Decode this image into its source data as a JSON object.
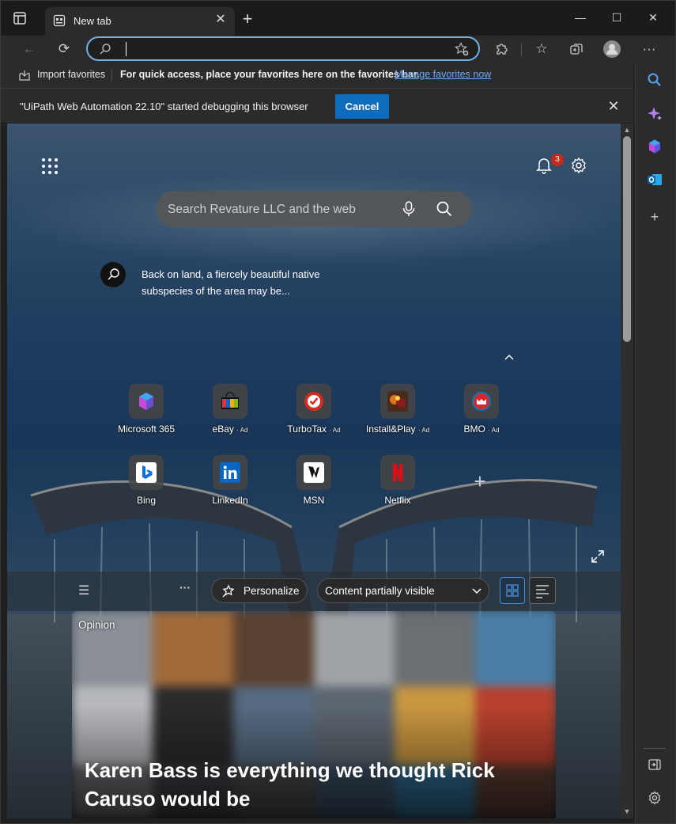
{
  "tab": {
    "title": "New tab"
  },
  "address": {
    "value": ""
  },
  "favorites_bar": {
    "import_label": "Import favorites",
    "message": "For quick access, place your favorites here on the favorites bar.",
    "manage_link": "Manage favorites now"
  },
  "infobar": {
    "message": "\"UiPath Web Automation 22.10\" started debugging this browser",
    "cancel_label": "Cancel"
  },
  "newtab": {
    "notification_count": "3",
    "search_placeholder": "Search Revature LLC and the web",
    "image_info": "Back on land, a fiercely beautiful native subspecies of the area may be...",
    "tiles": [
      {
        "label": "Microsoft 365",
        "ad": ""
      },
      {
        "label": "eBay",
        "ad": "· Ad"
      },
      {
        "label": "TurboTax",
        "ad": "· Ad"
      },
      {
        "label": "Install&Play",
        "ad": "· Ad"
      },
      {
        "label": "BMO",
        "ad": "· Ad"
      },
      {
        "label": "Bing",
        "ad": ""
      },
      {
        "label": "LinkedIn",
        "ad": ""
      },
      {
        "label": "MSN",
        "ad": ""
      },
      {
        "label": "Netflix",
        "ad": ""
      }
    ],
    "feed": {
      "personalize_label": "Personalize",
      "content_select": "Content partially visible"
    },
    "card": {
      "tag": "Opinion",
      "headline": "Karen Bass is everything we thought Rick Caruso would be"
    }
  },
  "colors": {
    "accent": "#0f6cbd",
    "link": "#6aa9ff",
    "badge": "#c42b1c"
  }
}
